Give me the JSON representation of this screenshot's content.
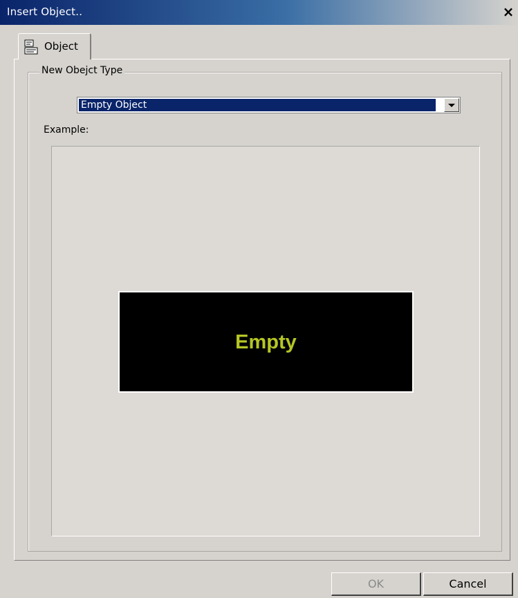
{
  "window": {
    "title": "Insert Object..",
    "close_label": "×"
  },
  "tabs": [
    {
      "label": "Object",
      "icon": "object-icon",
      "selected": true
    }
  ],
  "group": {
    "legend": "New Obejct Type",
    "object_type": {
      "selected_value": "Empty Object"
    },
    "example_label": "Example:",
    "preview": {
      "text": "Empty",
      "text_color": "#b5c625",
      "background": "#000000"
    }
  },
  "buttons": {
    "ok_label": "OK",
    "ok_enabled": false,
    "cancel_label": "Cancel"
  },
  "colors": {
    "titlebar": "#0a246a",
    "dialog_bg": "#d6d3ce",
    "selection": "#0a246a"
  }
}
